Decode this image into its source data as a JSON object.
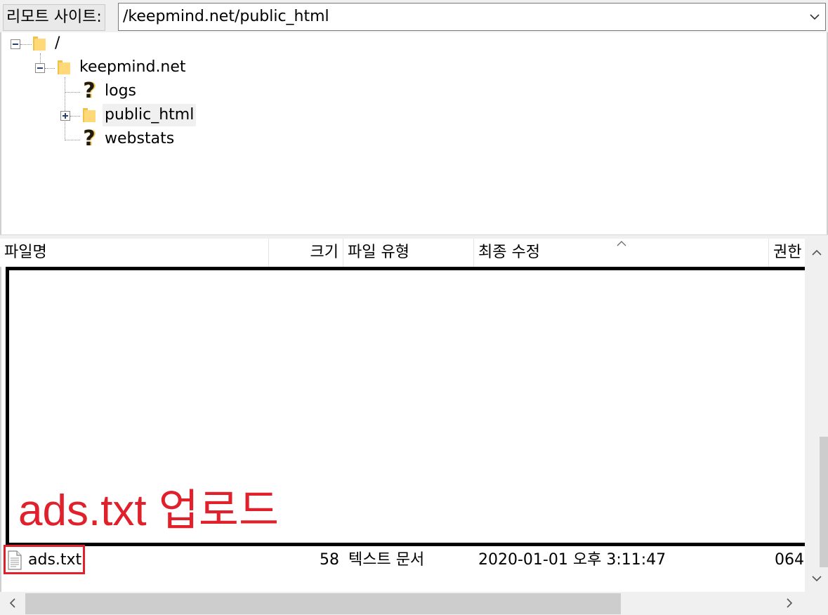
{
  "address_bar": {
    "label": "리모트 사이트:",
    "path": "/keepmind.net/public_html"
  },
  "tree": {
    "root": "/",
    "domain": "keepmind.net",
    "children": [
      "logs",
      "public_html",
      "webstats"
    ]
  },
  "list": {
    "columns": {
      "name": "파일명",
      "size": "크기",
      "type": "파일 유형",
      "modified": "최종 수정",
      "permissions": "권한"
    },
    "rows": [
      {
        "name": "ads.txt",
        "size": "58",
        "type": "텍스트 문서",
        "modified": "2020-01-01 오후 3:11:47",
        "permissions": "064"
      }
    ]
  },
  "annotation": {
    "text": "ads.txt 업로드",
    "color": "#e0202a"
  },
  "icons": [
    "folder-icon",
    "unknown-folder-icon",
    "text-file-icon",
    "chevron-down-icon",
    "sort-ascending-icon"
  ]
}
